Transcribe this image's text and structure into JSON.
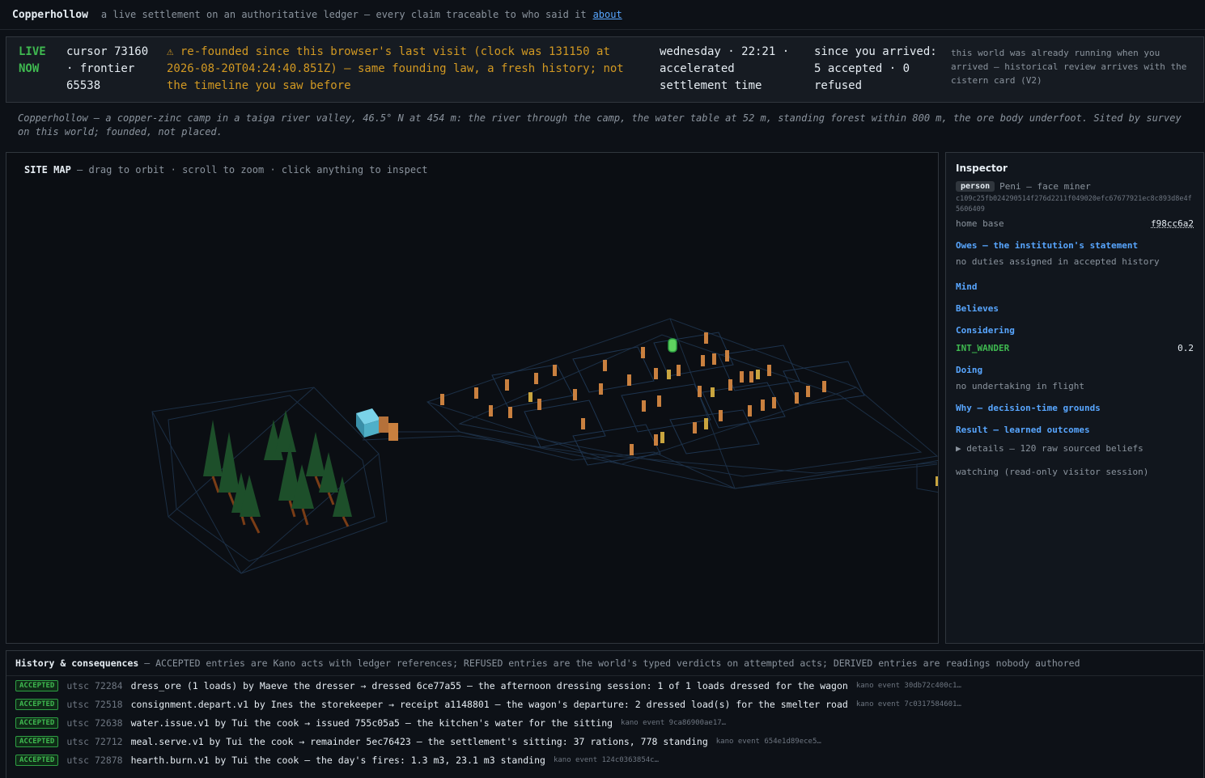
{
  "header": {
    "brand": "Copperhollow",
    "tagline": "a live settlement on an authoritative ledger — every claim traceable to who said it",
    "about_link": "about"
  },
  "status": {
    "live_label": "LIVE NOW",
    "cursor_text": "cursor 73160 · frontier 65538",
    "warning_icon": "⚠",
    "warning_text": "re-founded since this browser's last visit (clock was 131150 at 2026-08-20T04:24:40.851Z) — same founding law, a fresh history; not the timeline you saw before",
    "clock_text": "wednesday · 22:21 · accelerated settlement time",
    "arrived_text": "since you arrived: 5 accepted · 0 refused",
    "already_running_text": "this world was already running when you arrived — historical review arrives with the cistern card (V2)"
  },
  "description": "Copperhollow — a copper-zinc camp in a taiga river valley, 46.5° N at 454 m: the river through the camp, the water table at 52 m, standing forest within 800 m, the ore body underfoot. Sited by survey on this world; founded, not placed.",
  "sitemap": {
    "title": "SITE MAP",
    "hint": "— drag to orbit · scroll to zoom · click anything to inspect"
  },
  "inspector": {
    "title": "Inspector",
    "kind_badge": "person",
    "person_name": "Peni — face miner",
    "person_hash": "c109c25fb024290514f276d2211f049020efc67677921ec8c893d8e4f5606409",
    "home_base_label": "home base",
    "home_base_value": "f98cc6a2",
    "owes_label": "Owes — the institution's statement",
    "owes_text": "no duties assigned in accepted history",
    "mind_label": "Mind",
    "believes_label": "Believes",
    "considering_label": "Considering",
    "intent_name": "INT_WANDER",
    "intent_score": "0.2",
    "doing_label": "Doing",
    "doing_text": "no undertaking in flight",
    "why_label": "Why — decision-time grounds",
    "result_label": "Result — learned outcomes",
    "details_text": "▶ details — 120 raw sourced beliefs",
    "watching_text": "watching (read-only visitor session)"
  },
  "history": {
    "title": "History & consequences",
    "subtitle": "— ACCEPTED entries are Kano acts with ledger references; REFUSED entries are the world's typed verdicts on attempted acts; DERIVED entries are readings nobody authored",
    "rows": [
      {
        "badge": "ACCEPTED",
        "utsc": "utsc 72284",
        "text": "dress_ore (1 loads) by Maeve the dresser → dressed 6ce77a55 — the afternoon dressing session: 1 of 1 loads dressed for the wagon",
        "ref": "kano event 30db72c400c1…"
      },
      {
        "badge": "ACCEPTED",
        "utsc": "utsc 72518",
        "text": "consignment.depart.v1 by Ines the storekeeper → receipt a1148801 — the wagon's departure: 2 dressed load(s) for the smelter road",
        "ref": "kano event 7c0317584601…"
      },
      {
        "badge": "ACCEPTED",
        "utsc": "utsc 72638",
        "text": "water.issue.v1 by Tui the cook → issued 755c05a5 — the kitchen's water for the sitting",
        "ref": "kano event 9ca86900ae17…"
      },
      {
        "badge": "ACCEPTED",
        "utsc": "utsc 72712",
        "text": "meal.serve.v1 by Tui the cook → remainder 5ec76423 — the settlement's sitting: 37 rations, 778 standing",
        "ref": "kano event 654e1d89ece5…"
      },
      {
        "badge": "ACCEPTED",
        "utsc": "utsc 72878",
        "text": "hearth.burn.v1 by Tui the cook — the day's fires: 1.3 m3, 23.1 m3 standing",
        "ref": "kano event 124c0363854c…"
      }
    ]
  }
}
